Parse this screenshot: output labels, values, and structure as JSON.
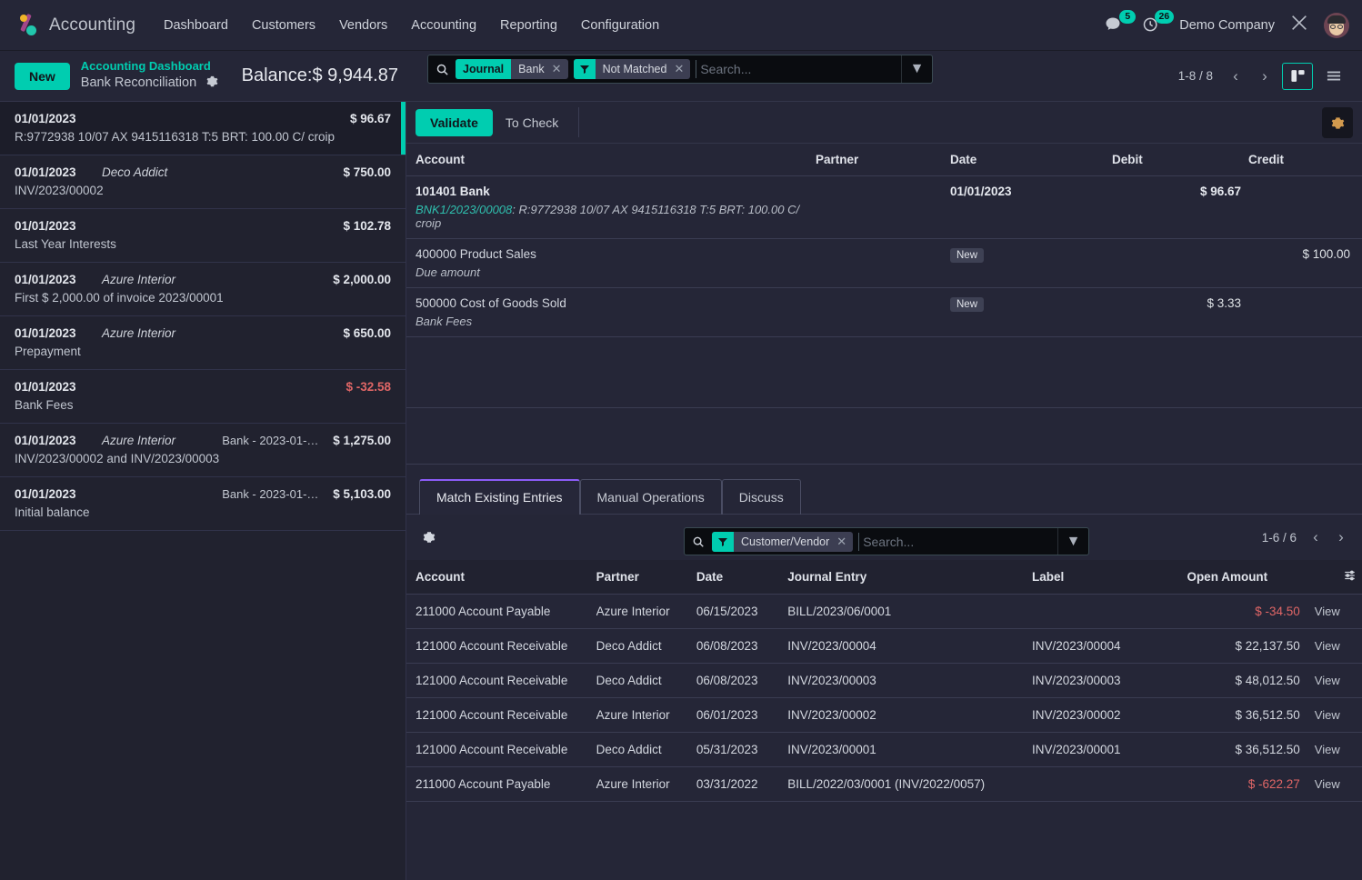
{
  "navbar": {
    "brand": "Accounting",
    "menu": [
      "Dashboard",
      "Customers",
      "Vendors",
      "Accounting",
      "Reporting",
      "Configuration"
    ],
    "messages_count": "5",
    "activities_count": "26",
    "company": "Demo Company"
  },
  "control_panel": {
    "new_label": "New",
    "breadcrumb_parent": "Accounting Dashboard",
    "breadcrumb_current": "Bank Reconciliation",
    "balance_label": "Balance:",
    "balance_value": "$ 9,944.87",
    "pager": "1-8 / 8"
  },
  "search": {
    "facets": [
      {
        "key": "Journal",
        "value": "Bank",
        "icon": ""
      },
      {
        "key": "filter-icon",
        "value": "Not Matched",
        "icon": "filter"
      }
    ],
    "placeholder": "Search..."
  },
  "statement_lines": [
    {
      "date": "01/01/2023",
      "partner": "",
      "ref": "",
      "amount": "$ 96.67",
      "negative": false,
      "label": "R:9772938 10/07 AX 9415116318 T:5 BRT: 100.00 C/ croip",
      "selected": true
    },
    {
      "date": "01/01/2023",
      "partner": "Deco Addict",
      "ref": "",
      "amount": "$ 750.00",
      "negative": false,
      "label": "INV/2023/00002",
      "selected": false
    },
    {
      "date": "01/01/2023",
      "partner": "",
      "ref": "",
      "amount": "$ 102.78",
      "negative": false,
      "label": "Last Year Interests",
      "selected": false
    },
    {
      "date": "01/01/2023",
      "partner": "Azure Interior",
      "ref": "",
      "amount": "$ 2,000.00",
      "negative": false,
      "label": "First $ 2,000.00 of invoice 2023/00001",
      "selected": false
    },
    {
      "date": "01/01/2023",
      "partner": "Azure Interior",
      "ref": "",
      "amount": "$ 650.00",
      "negative": false,
      "label": "Prepayment",
      "selected": false
    },
    {
      "date": "01/01/2023",
      "partner": "",
      "ref": "",
      "amount": "$ -32.58",
      "negative": true,
      "label": "Bank Fees",
      "selected": false
    },
    {
      "date": "01/01/2023",
      "partner": "Azure Interior",
      "ref": "Bank - 2023-01-0…",
      "amount": "$ 1,275.00",
      "negative": false,
      "label": "INV/2023/00002 and INV/2023/00003",
      "selected": false
    },
    {
      "date": "01/01/2023",
      "partner": "",
      "ref": "Bank - 2023-01-0…",
      "amount": "$ 5,103.00",
      "negative": false,
      "label": "Initial balance",
      "selected": false
    }
  ],
  "right_panel": {
    "validate_label": "Validate",
    "to_check_label": "To Check",
    "journal_headers": [
      "Account",
      "Partner",
      "Date",
      "Debit",
      "Credit"
    ],
    "journal_lines": [
      {
        "account": "101401 Bank",
        "bold": true,
        "sub_move": "BNK1/2023/00008",
        "sub_text": ": R:9772938 10/07 AX 9415116318 T:5 BRT: 100.00 C/ croip",
        "partner": "",
        "date": "01/01/2023",
        "badge": "",
        "debit": "$ 96.67",
        "credit": "",
        "trash": false
      },
      {
        "account": "400000 Product Sales",
        "bold": false,
        "sub_move": "",
        "sub_text": "Due amount",
        "partner": "",
        "date": "",
        "badge": "New",
        "debit": "",
        "credit": "$ 100.00",
        "trash": true
      },
      {
        "account": "500000 Cost of Goods Sold",
        "bold": false,
        "sub_move": "",
        "sub_text": "Bank Fees",
        "partner": "",
        "date": "",
        "badge": "New",
        "debit": "$ 3.33",
        "credit": "",
        "trash": true
      }
    ]
  },
  "tabs": [
    {
      "label": "Match Existing Entries",
      "active": true
    },
    {
      "label": "Manual Operations",
      "active": false
    },
    {
      "label": "Discuss",
      "active": false
    }
  ],
  "inner_search": {
    "facet_value": "Customer/Vendor",
    "placeholder": "Search...",
    "pager": "1-6 / 6"
  },
  "matching": {
    "headers": [
      "Account",
      "Partner",
      "Date",
      "Journal Entry",
      "Label",
      "Open Amount"
    ],
    "view_label": "View",
    "rows": [
      {
        "account": "211000 Account Payable",
        "partner": "Azure Interior",
        "date": "06/15/2023",
        "journal_entry": "BILL/2023/06/0001",
        "label": "",
        "open_amount": "$ -34.50",
        "negative": true
      },
      {
        "account": "121000 Account Receivable",
        "partner": "Deco Addict",
        "date": "06/08/2023",
        "journal_entry": "INV/2023/00004",
        "label": "INV/2023/00004",
        "open_amount": "$ 22,137.50",
        "negative": false
      },
      {
        "account": "121000 Account Receivable",
        "partner": "Deco Addict",
        "date": "06/08/2023",
        "journal_entry": "INV/2023/00003",
        "label": "INV/2023/00003",
        "open_amount": "$ 48,012.50",
        "negative": false
      },
      {
        "account": "121000 Account Receivable",
        "partner": "Azure Interior",
        "date": "06/01/2023",
        "journal_entry": "INV/2023/00002",
        "label": "INV/2023/00002",
        "open_amount": "$ 36,512.50",
        "negative": false
      },
      {
        "account": "121000 Account Receivable",
        "partner": "Deco Addict",
        "date": "05/31/2023",
        "journal_entry": "INV/2023/00001",
        "label": "INV/2023/00001",
        "open_amount": "$ 36,512.50",
        "negative": false
      },
      {
        "account": "211000 Account Payable",
        "partner": "Azure Interior",
        "date": "03/31/2022",
        "journal_entry": "BILL/2022/03/0001 (INV/2022/0057)",
        "label": "",
        "open_amount": "$ -622.27",
        "negative": true
      }
    ]
  },
  "colors": {
    "accent": "#00cdb0",
    "danger": "#e06666",
    "tab_active_border": "#8b5cf6",
    "panel_bg": "#252637",
    "list_bg": "#21222f"
  }
}
